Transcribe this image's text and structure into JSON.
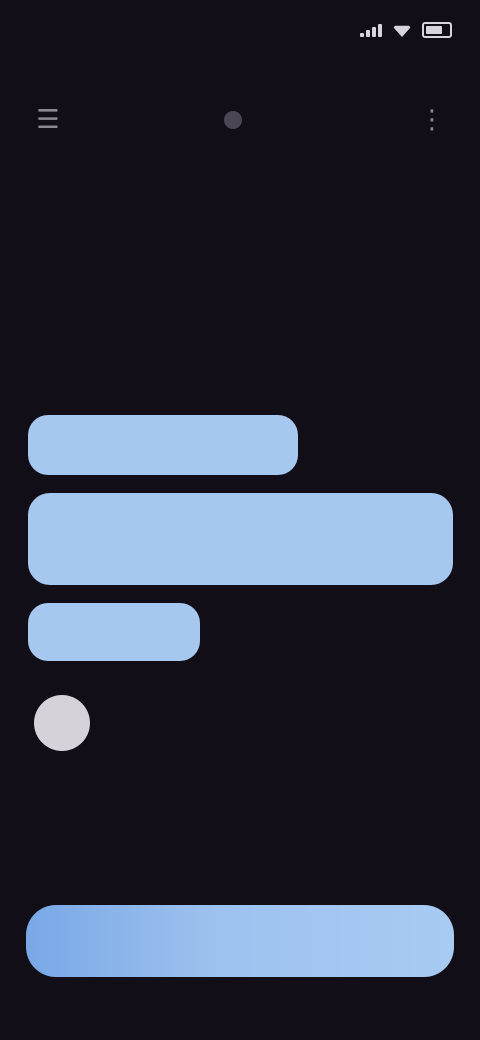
{
  "status_bar": {
    "time": "",
    "icons": [
      "signal-icon",
      "wifi-icon",
      "battery-icon"
    ]
  },
  "toolbar": {
    "left_icon": "menu-icon",
    "title": "",
    "right_icon": "more-icon"
  },
  "messages": [
    {
      "text": ""
    },
    {
      "text": ""
    },
    {
      "text": ""
    }
  ],
  "input": {
    "placeholder": ""
  },
  "colors": {
    "background": "#110e17",
    "bubble": "#a6c8ef",
    "input_gradient_start": "#79a8e6",
    "input_gradient_end": "#a8cbf2",
    "avatar": "#d6d2da"
  }
}
